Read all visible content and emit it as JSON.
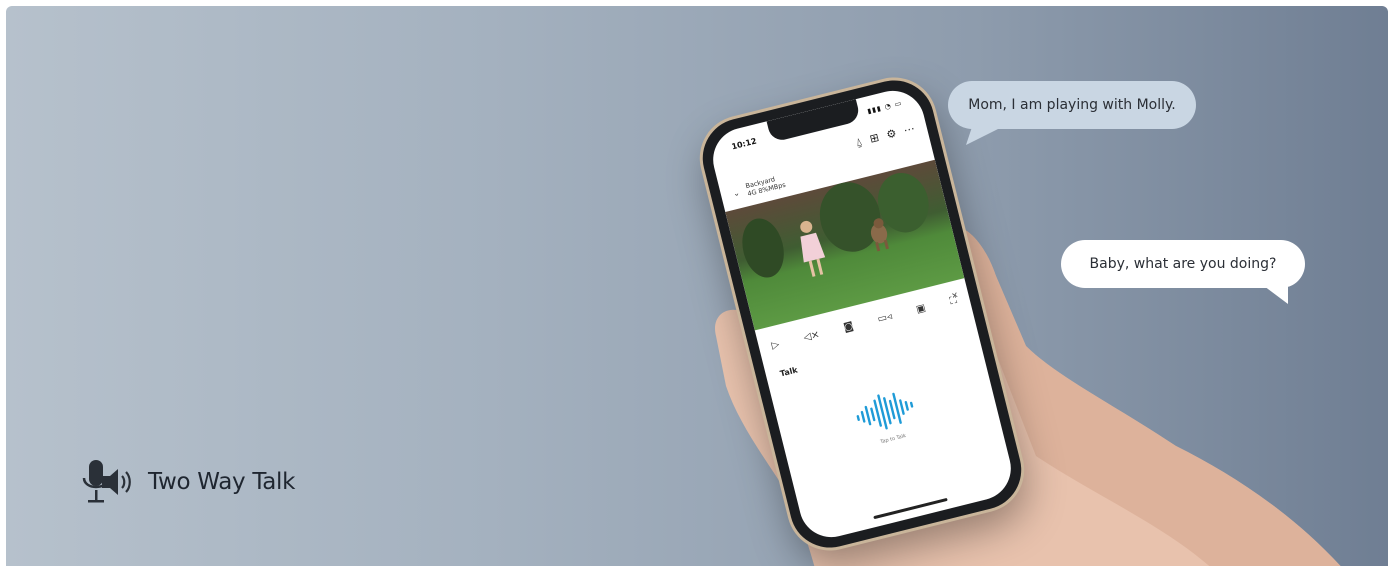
{
  "feature": {
    "label": "Two Way Talk",
    "icon": "microphone-speaker-icon"
  },
  "bubbles": {
    "child_message": "Mom, I am playing with Molly.",
    "parent_message": "Baby, what are you doing?"
  },
  "phone": {
    "status_time": "10:12",
    "camera_name": "Backyard",
    "stream_quality": "4G 8%MBps",
    "talk_label": "Talk",
    "tap_hint": "Tap to Talk"
  },
  "colors": {
    "bg_left": "#b6c1cc",
    "bg_right": "#6f7e93",
    "wave_accent": "#1f9bd7",
    "bubble_child": "#c9d6e3",
    "bubble_parent": "#ffffff"
  }
}
